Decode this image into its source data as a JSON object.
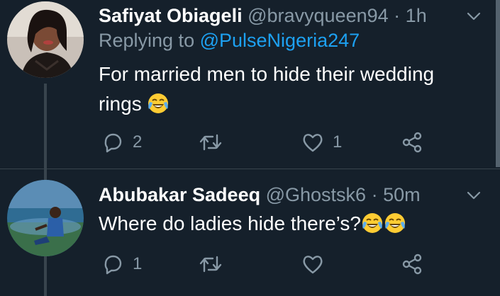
{
  "tweets": [
    {
      "name": "Safiyat Obiageli",
      "handle": "@bravyqueen94",
      "separator": "·",
      "time": "1h",
      "replying_prefix": "Replying to",
      "replying_to": "@PulseNigeria247",
      "text_line1": "For married men to hide their wedding",
      "text_line2": "rings",
      "emoji": [
        "face-with-tears-of-joy"
      ],
      "counts": {
        "replies": "2",
        "retweets": "",
        "likes": "1"
      }
    },
    {
      "name": "Abubakar Sadeeq",
      "handle": "@Ghostsk6",
      "separator": "·",
      "time": "50m",
      "text": "Where do ladies hide there’s?",
      "emoji": [
        "face-with-tears-of-joy",
        "face-with-tears-of-joy"
      ],
      "counts": {
        "replies": "1",
        "retweets": "",
        "likes": ""
      }
    }
  ],
  "icons": {
    "reply": "reply-icon",
    "retweet": "retweet-icon",
    "like": "heart-icon",
    "share": "share-icon",
    "menu": "chevron-down-icon"
  },
  "colors": {
    "background": "#15202b",
    "secondary_text": "#8899a6",
    "link": "#1da1f2",
    "divider": "#38444d"
  }
}
